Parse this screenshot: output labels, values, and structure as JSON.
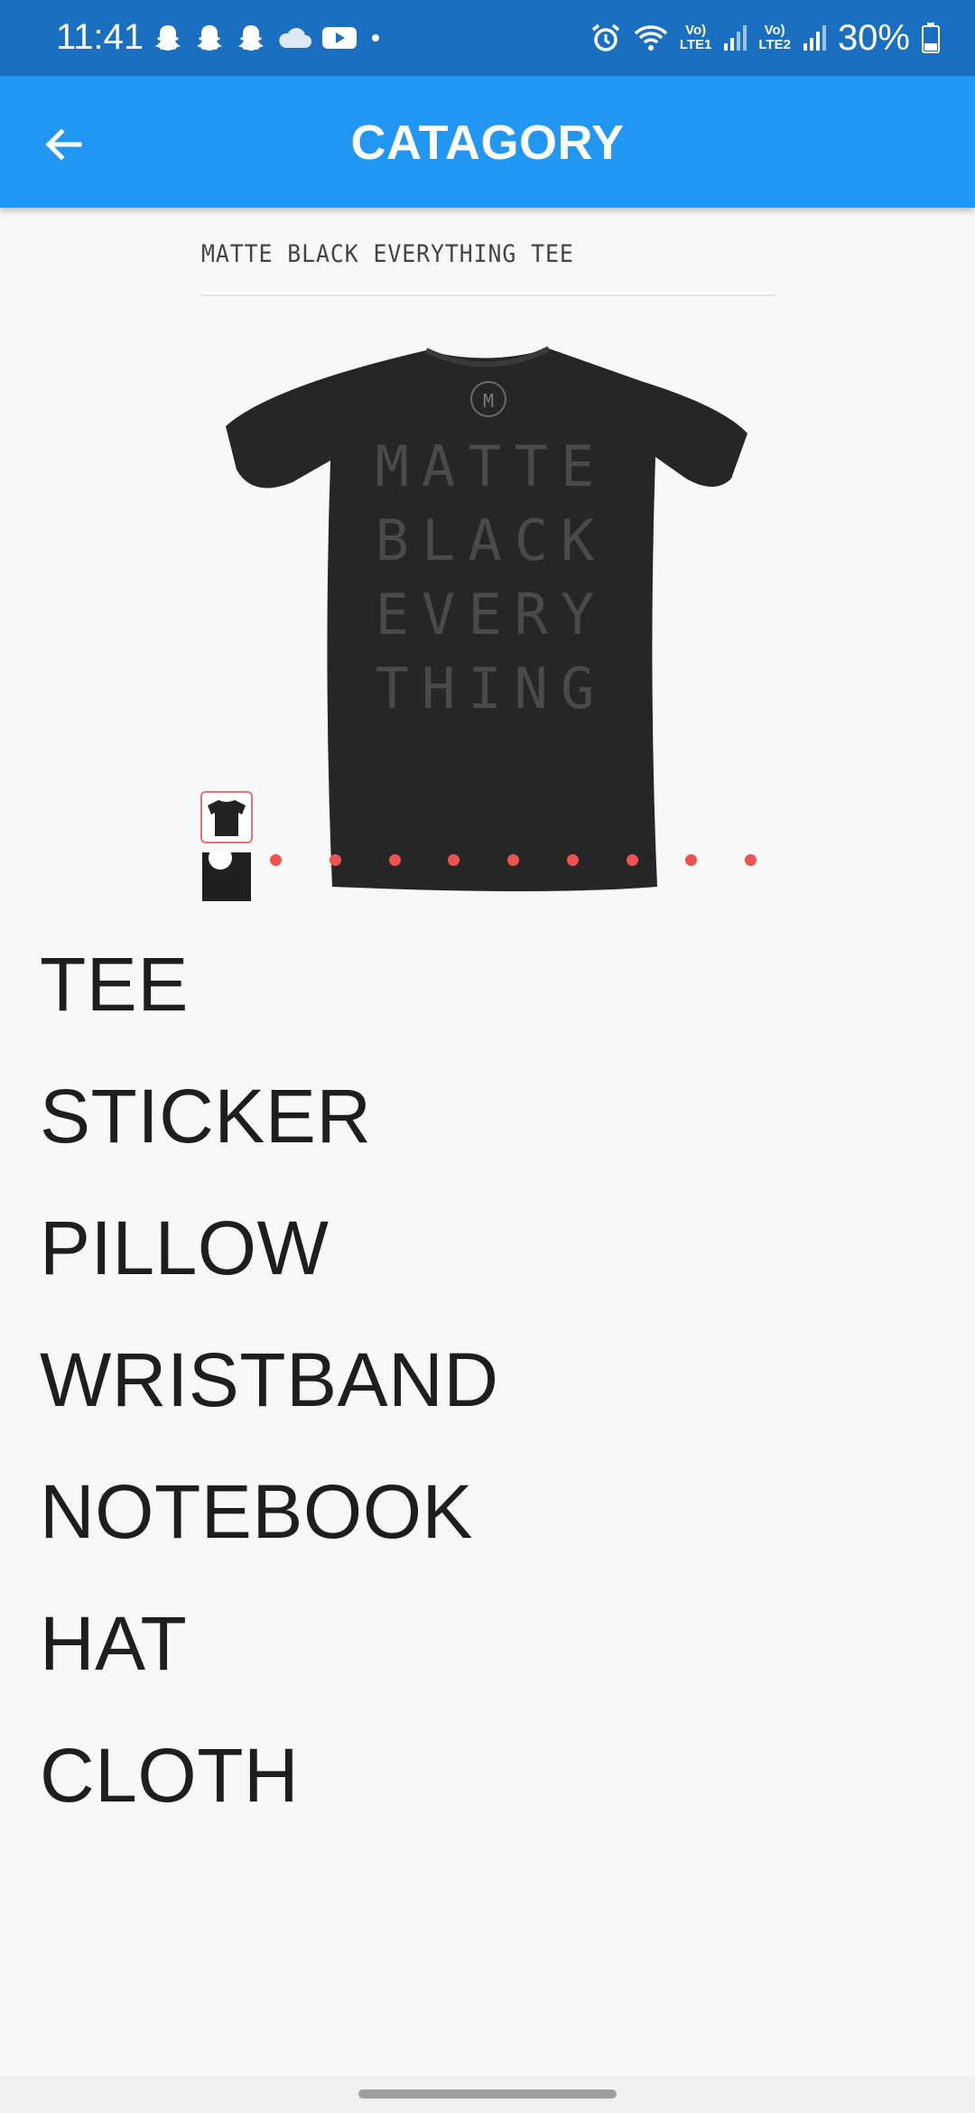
{
  "status_bar": {
    "time": "11:41",
    "icons": [
      "snapchat-icon",
      "snapchat-icon",
      "snapchat-icon",
      "cloud-icon",
      "youtube-icon",
      "dot-icon",
      "alarm-icon",
      "wifi-icon",
      "signal-icon",
      "signal-icon",
      "battery-icon"
    ],
    "sim1_label_top": "Vo)",
    "sim1_label_bottom": "LTE1",
    "sim2_label_top": "Vo)",
    "sim2_label_bottom": "LTE2",
    "battery": "30%",
    "battery_level": 0.3
  },
  "app_bar": {
    "title": "CATAGORY",
    "back_icon": "arrow-back-icon",
    "color": "#2196F3"
  },
  "product": {
    "title": "MATTE BLACK EVERYTHING TEE",
    "shirt_print": [
      "MATTE",
      "BLACK",
      "EVERY",
      "THING"
    ],
    "logo_letter": "M",
    "thumbnails": 2,
    "carousel_dots": 9,
    "accent_color": "#EF5350"
  },
  "categories": [
    "TEE",
    "STICKER",
    "PILLOW",
    "WRISTBAND",
    "NOTEBOOK",
    "HAT",
    "CLOTH"
  ]
}
